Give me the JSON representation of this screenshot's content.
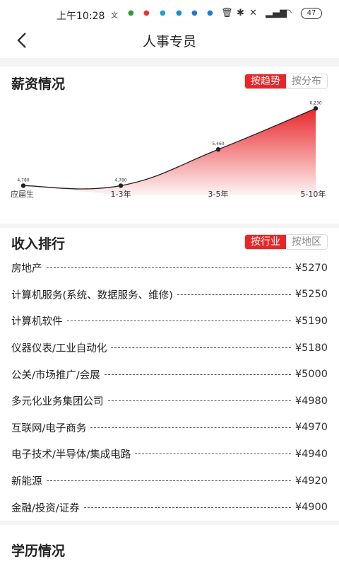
{
  "status": {
    "time": "上午10:28",
    "battery": "47"
  },
  "header": {
    "title": "人事专员"
  },
  "salary": {
    "title": "薪资情况",
    "toggle": [
      "按趋势",
      "按分布"
    ],
    "active_toggle": 0
  },
  "chart_data": {
    "type": "area",
    "categories": [
      "应届生",
      "1-3年",
      "3-5年",
      "5-10年"
    ],
    "values": [
      4780,
      4780,
      5460,
      6230
    ],
    "data_labels": [
      "4,780",
      "4,780",
      "5,460",
      "6,230"
    ],
    "title": "",
    "xlabel": "",
    "ylabel": "",
    "grid": false,
    "color": "#e8262a"
  },
  "income": {
    "title": "收入排行",
    "toggle": [
      "按行业",
      "按地区"
    ],
    "active_toggle": 0,
    "items": [
      {
        "name": "房地产",
        "value": "¥5270"
      },
      {
        "name": "计算机服务(系统、数据服务、维修)",
        "value": "¥5250"
      },
      {
        "name": "计算机软件",
        "value": "¥5190"
      },
      {
        "name": "仪器仪表/工业自动化",
        "value": "¥5180"
      },
      {
        "name": "公关/市场推广/会展",
        "value": "¥5000"
      },
      {
        "name": "多元化业务集团公司",
        "value": "¥4980"
      },
      {
        "name": "互联网/电子商务",
        "value": "¥4970"
      },
      {
        "name": "电子技术/半导体/集成电路",
        "value": "¥4940"
      },
      {
        "name": "新能源",
        "value": "¥4920"
      },
      {
        "name": "金融/投资/证券",
        "value": "¥4900"
      }
    ]
  },
  "education": {
    "title": "学历情况"
  }
}
